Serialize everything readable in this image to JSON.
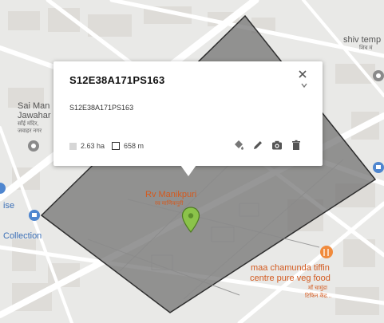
{
  "map": {
    "accent": "#8bc34a",
    "polygon_color": "#6f6f6f",
    "labels": {
      "top_right": "shiv temp",
      "top_right_sub": "शिव मं",
      "left_poi": [
        "Sai Man",
        "Jawahar"
      ],
      "left_poi_sub": [
        "साँई मंदिर,",
        "जवाहर नगर"
      ],
      "left_partial": "ise",
      "collection": "Collection",
      "place": "Rv Manikpuri",
      "place_sub": "रव माणिकपुरी",
      "tiffin": [
        "maa chamunda tiffin",
        "centre pure veg food"
      ],
      "tiffin_sub": [
        "माँ चामुंडा",
        "टिफिन केंद्र..."
      ]
    }
  },
  "popup": {
    "title": "S12E38A171PS163",
    "description": "S12E38A171PS163",
    "area": "2.63 ha",
    "perimeter": "658 m",
    "icons": [
      "paint-bucket-icon",
      "pencil-icon",
      "camera-icon",
      "trash-icon",
      "close-icon",
      "chevron-down-icon"
    ]
  }
}
